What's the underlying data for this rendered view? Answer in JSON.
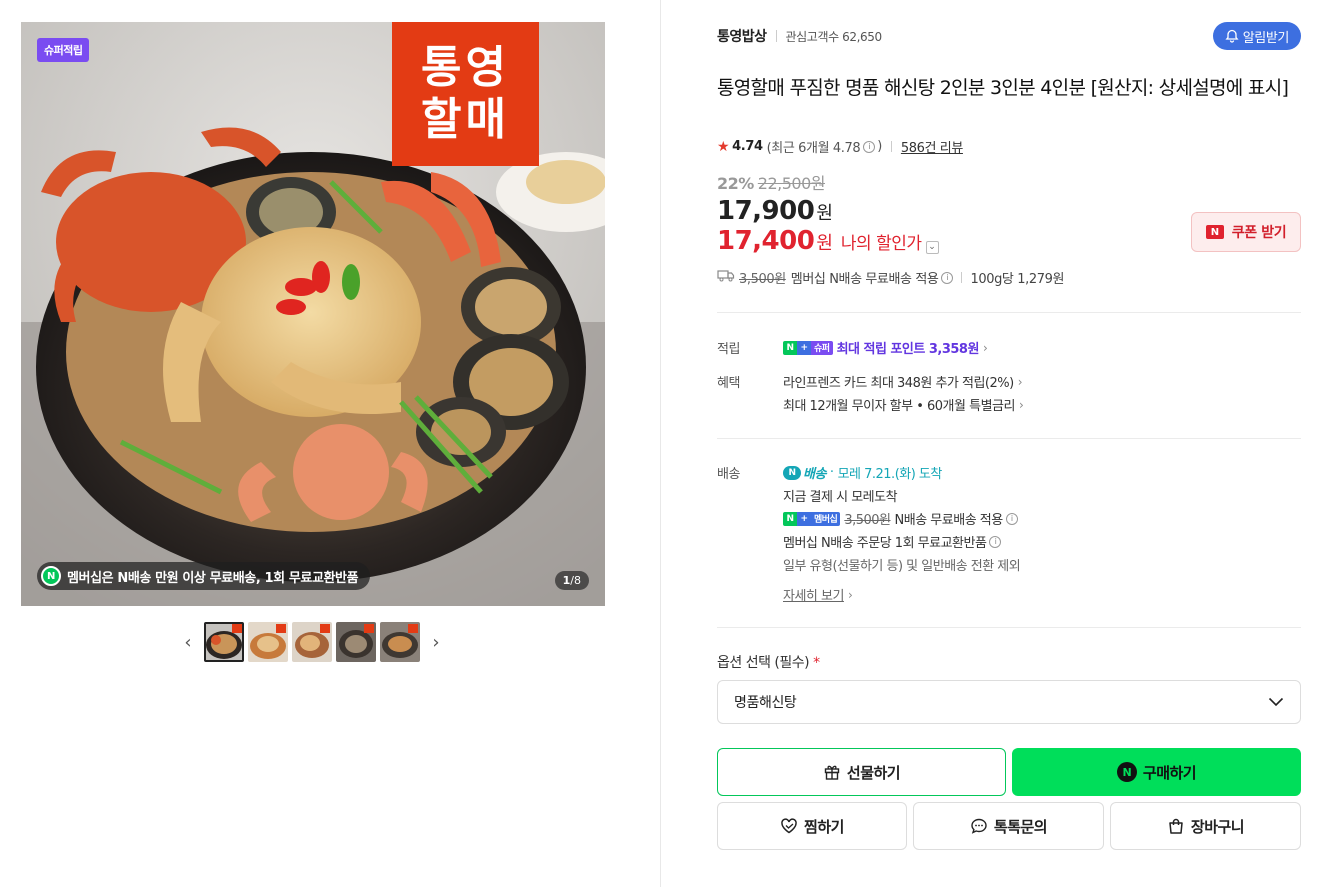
{
  "gallery": {
    "super_badge": "슈퍼적립",
    "logo_line1": "통영",
    "logo_line2": "할매",
    "membership_text": "멤버십은 N배송 만원 이상 무료배송, 1회 무료교환반품",
    "membership_icon_text": "N",
    "counter_current": "1",
    "counter_total": "/8",
    "thumbnail_count": 5,
    "prev_arrow": "‹",
    "next_arrow": "›"
  },
  "store": {
    "name": "통영밥상",
    "fans": "관심고객수 62,650",
    "alarm_label": "알림받기"
  },
  "product": {
    "title": "통영할매 푸짐한 명품 해신탕 2인분 3인분 4인분 [원산지: 상세설명에 표시]"
  },
  "rating": {
    "score": "4.74",
    "recent": "(최근 6개월 4.78",
    "recent_close": ")",
    "reviews": "586건 리뷰"
  },
  "price": {
    "discount": "22%",
    "original": "22,500원",
    "sale": "17,900",
    "currency": "원",
    "my_price": "17,400",
    "my_price_label": "나의 할인가",
    "coupon_label": "쿠폰 받기",
    "coupon_icon": "N"
  },
  "shipping": {
    "old_fee": "3,500원",
    "text": "멤버십 N배송 무료배송 적용",
    "unit_price": "100g당 1,279원"
  },
  "benefits": {
    "points_label": "적립",
    "points_text": "최대 적립 포인트 3,358원",
    "super_tag": "슈퍼",
    "benefit_label": "혜택",
    "card_line": "라인프렌즈 카드 최대 348원 추가 적립(2%)",
    "installment_line": "최대 12개월 무이자 할부 • 60개월 특별금리"
  },
  "delivery": {
    "label": "배송",
    "tag": "배송",
    "arrival": "모레 7.21.(화) 도착",
    "line1": "지금 결제 시 모레도착",
    "membership_tag": "멤버십",
    "old_fee": "3,500원",
    "line2": "N배송 무료배송 적용",
    "line3": "멤버십 N배송 주문당 1회 무료교환반품",
    "line4": "일부 유형(선물하기 등) 및 일반배송 전환 제외",
    "more": "자세히 보기"
  },
  "option": {
    "label": "옵션 선택 (필수)",
    "required_mark": "*",
    "selected": "명품해신탕"
  },
  "actions": {
    "gift": "선물하기",
    "buy": "구매하기",
    "wish": "찜하기",
    "talk": "톡톡문의",
    "cart": "장바구니"
  },
  "colors": {
    "naver_green": "#03c75a",
    "buy_green": "#00de5a",
    "price_red": "#e0232f",
    "alarm_blue": "#3d6fe0",
    "super_purple": "#7a4cf1",
    "delivery_teal": "#14a6b6",
    "logo_red": "#e33b14"
  }
}
